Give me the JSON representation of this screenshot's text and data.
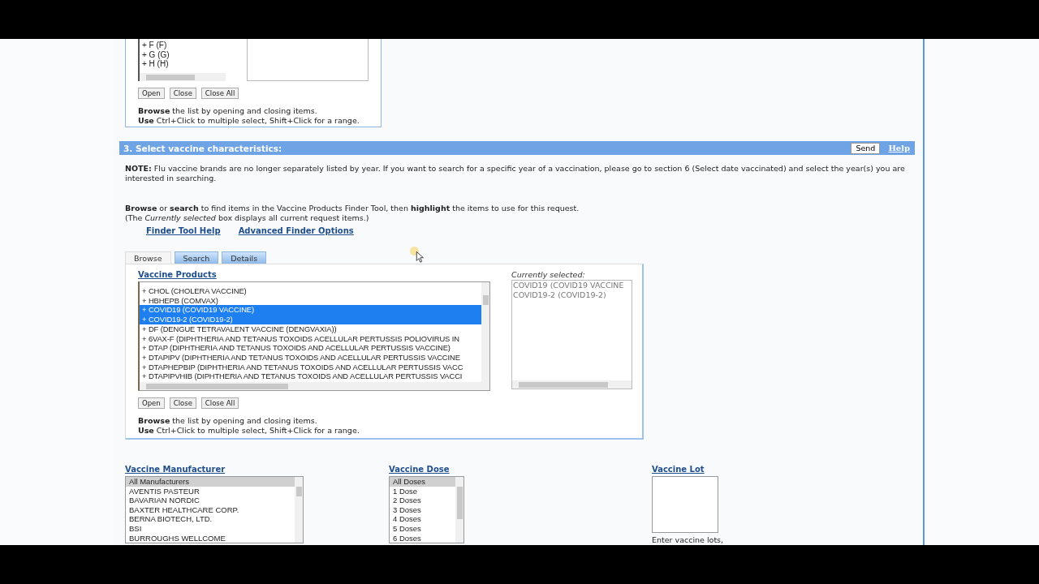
{
  "top_finder": {
    "items": [
      {
        "label": "+ F  (F)",
        "selected": false
      },
      {
        "label": "+ G  (G)",
        "selected": false
      },
      {
        "label": "+ H  (H)",
        "selected": false
      }
    ],
    "buttons": [
      "Open",
      "Close",
      "Close All"
    ],
    "help": [
      "**Browse** the list by opening and closing items.",
      "**Use** Ctrl+Click to multiple select, Shift+Click for a range."
    ]
  },
  "section": {
    "title": "3. Select vaccine characteristics:",
    "send": "Send",
    "help_link": "Help",
    "note": "**NOTE:** Flu vaccine brands are no longer separately listed by year. If you want to search for a specific year of a vaccination, please go to section 6 (Select date vaccinated) and select the year(s) you are interested in searching.",
    "intro": [
      "**Browse** or **search** to find items in the Vaccine Products Finder Tool, then **highlight** the items to use for this request.",
      "(The *Currently selected* box displays all current request items.)"
    ],
    "links": [
      "Finder Tool Help",
      "Advanced Finder Options"
    ],
    "tabs": [
      {
        "label": "Browse",
        "selected": true
      },
      {
        "label": "Search",
        "selected": false
      },
      {
        "label": "Details",
        "selected": false
      }
    ],
    "products": {
      "heading": "Vaccine Products",
      "items": [
        {
          "label": "+ CHOL  (CHOLERA VACCINE)",
          "selected": false
        },
        {
          "label": "+ HBHEPB  (COMVAX)",
          "selected": false
        },
        {
          "label": "+ COVID19  (COVID19 VACCINE)",
          "selected": true
        },
        {
          "label": "+ COVID19-2  (COVID19-2)",
          "selected": true
        },
        {
          "label": "+ DF  (DENGUE TETRAVALENT VACCINE (DENGVAXIA))",
          "selected": false
        },
        {
          "label": "+ 6VAX-F  (DIPHTHERIA AND TETANUS TOXOIDS ACELLULAR PERTUSSIS POLIOVIRUS IN",
          "selected": false
        },
        {
          "label": "+ DTAP  (DIPHTHERIA AND TETANUS TOXOIDS AND ACELLULAR PERTUSSIS VACCINE)",
          "selected": false
        },
        {
          "label": "+ DTAPIPV  (DIPHTHERIA AND TETANUS TOXOIDS AND ACELLULAR PERTUSSIS VACCINE",
          "selected": false
        },
        {
          "label": "+ DTAPHEPBIP  (DIPHTHERIA AND TETANUS TOXOIDS AND ACELLULAR PERTUSSIS VACC",
          "selected": false
        },
        {
          "label": "+ DTAPIPVHIB  (DIPHTHERIA AND TETANUS TOXOIDS AND ACELLULAR PERTUSSIS VACCI",
          "selected": false
        }
      ]
    },
    "buttons": [
      "Open",
      "Close",
      "Close All"
    ],
    "help": [
      "**Browse** the list by opening and closing items.",
      "**Use** Ctrl+Click to multiple select, Shift+Click for a range."
    ],
    "currently_selected": {
      "label": "Currently selected:",
      "items": [
        "COVID19 (COVID19 VACCINE",
        "COVID19-2 (COVID19-2)"
      ]
    },
    "manufacturer": {
      "heading": "Vaccine Manufacturer",
      "items": [
        {
          "label": "All Manufacturers",
          "selected": true
        },
        {
          "label": "AVENTIS PASTEUR",
          "selected": false
        },
        {
          "label": "BAVARIAN NORDIC",
          "selected": false
        },
        {
          "label": "BAXTER HEALTHCARE CORP.",
          "selected": false
        },
        {
          "label": "BERNA BIOTECH, LTD.",
          "selected": false
        },
        {
          "label": "BSI",
          "selected": false
        },
        {
          "label": "BURROUGHS WELLCOME",
          "selected": false
        }
      ]
    },
    "dose": {
      "heading": "Vaccine Dose",
      "items": [
        {
          "label": "All Doses",
          "selected": true
        },
        {
          "label": "1 Dose",
          "selected": false
        },
        {
          "label": "2 Doses",
          "selected": false
        },
        {
          "label": "3 Doses",
          "selected": false
        },
        {
          "label": "4 Doses",
          "selected": false
        },
        {
          "label": "5 Doses",
          "selected": false
        },
        {
          "label": "6 Doses",
          "selected": false
        }
      ]
    },
    "lot": {
      "heading": "Vaccine Lot",
      "hint": "Enter vaccine lots,"
    }
  }
}
